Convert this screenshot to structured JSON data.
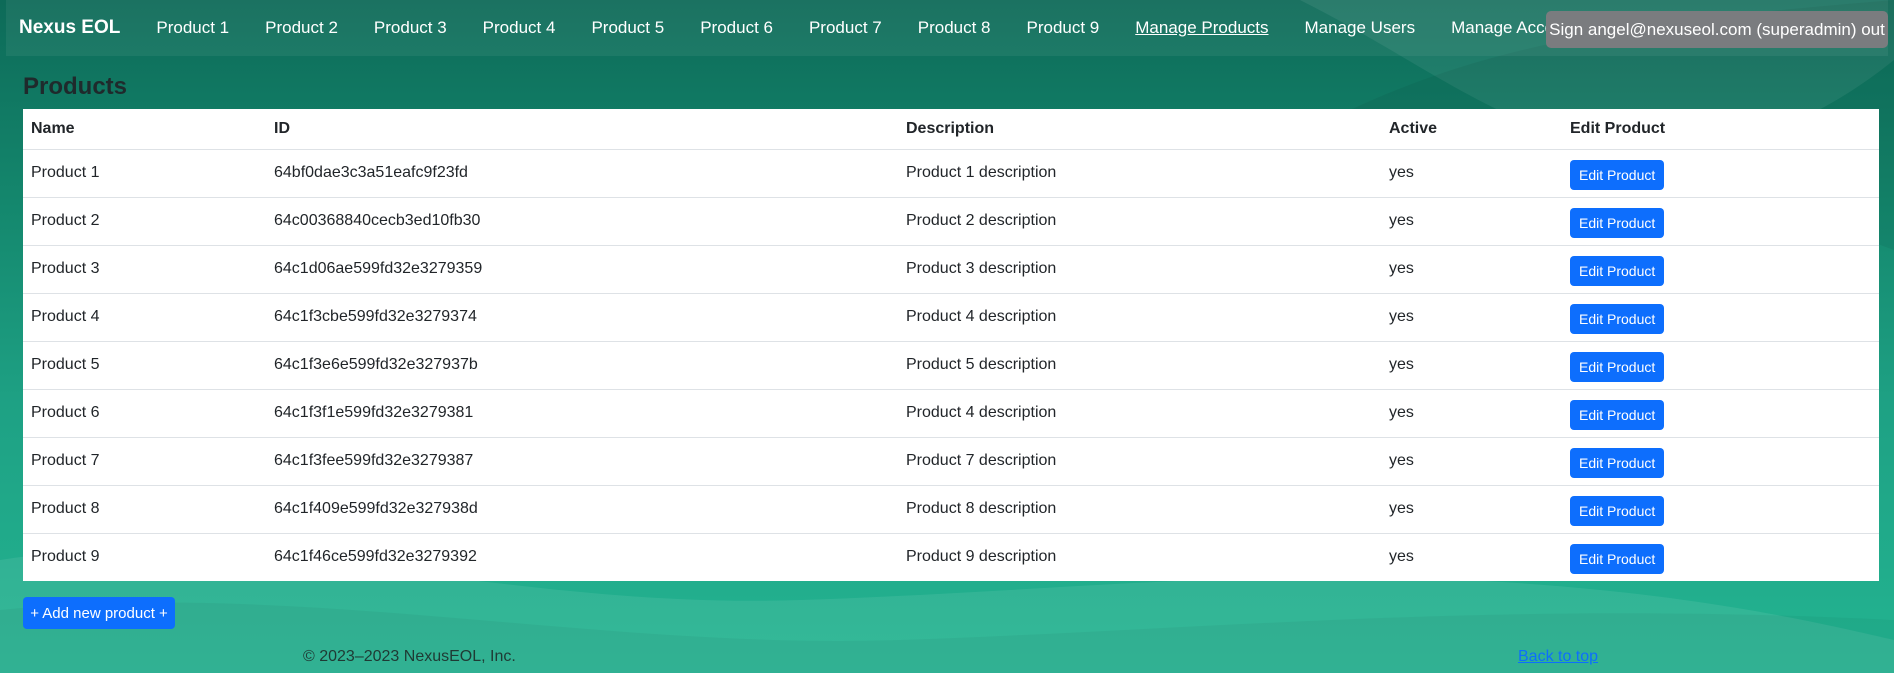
{
  "brand": "Nexus EOL",
  "nav": {
    "products": [
      "Product 1",
      "Product 2",
      "Product 3",
      "Product 4",
      "Product 5",
      "Product 6",
      "Product 7",
      "Product 8",
      "Product 9"
    ],
    "manage_products": "Manage Products",
    "manage_users": "Manage Users",
    "manage_accounts": "Manage Accounts",
    "sign_out": "Sign angel@nexuseol.com (superadmin) out"
  },
  "page": {
    "title": "Products",
    "add_button": "+ Add new product +"
  },
  "table": {
    "headers": [
      "Name",
      "ID",
      "Description",
      "Active",
      "Edit Product"
    ],
    "rows": [
      {
        "name": "Product 1",
        "id": "64bf0dae3c3a51eafc9f23fd",
        "description": "Product 1 description",
        "active": "yes",
        "action": "Edit Product"
      },
      {
        "name": "Product 2",
        "id": "64c00368840cecb3ed10fb30",
        "description": "Product 2 description",
        "active": "yes",
        "action": "Edit Product"
      },
      {
        "name": "Product 3",
        "id": "64c1d06ae599fd32e3279359",
        "description": "Product 3 description",
        "active": "yes",
        "action": "Edit Product"
      },
      {
        "name": "Product 4",
        "id": "64c1f3cbe599fd32e3279374",
        "description": "Product 4 description",
        "active": "yes",
        "action": "Edit Product"
      },
      {
        "name": "Product 5",
        "id": "64c1f3e6e599fd32e327937b",
        "description": "Product 5 description",
        "active": "yes",
        "action": "Edit Product"
      },
      {
        "name": "Product 6",
        "id": "64c1f3f1e599fd32e3279381",
        "description": "Product 4 description",
        "active": "yes",
        "action": "Edit Product"
      },
      {
        "name": "Product 7",
        "id": "64c1f3fee599fd32e3279387",
        "description": "Product 7 description",
        "active": "yes",
        "action": "Edit Product"
      },
      {
        "name": "Product 8",
        "id": "64c1f409e599fd32e327938d",
        "description": "Product 8 description",
        "active": "yes",
        "action": "Edit Product"
      },
      {
        "name": "Product 9",
        "id": "64c1f46ce599fd32e3279392",
        "description": "Product 9 description",
        "active": "yes",
        "action": "Edit Product"
      }
    ]
  },
  "footer": {
    "copyright": "© 2023–2023 NexusEOL, Inc.",
    "back_to_top": "Back to top"
  },
  "colors": {
    "primary": "#0d6efd",
    "background_dark": "#0d6a58",
    "background_light": "#23b491",
    "sign_out_bg": "#7a7c7f"
  }
}
